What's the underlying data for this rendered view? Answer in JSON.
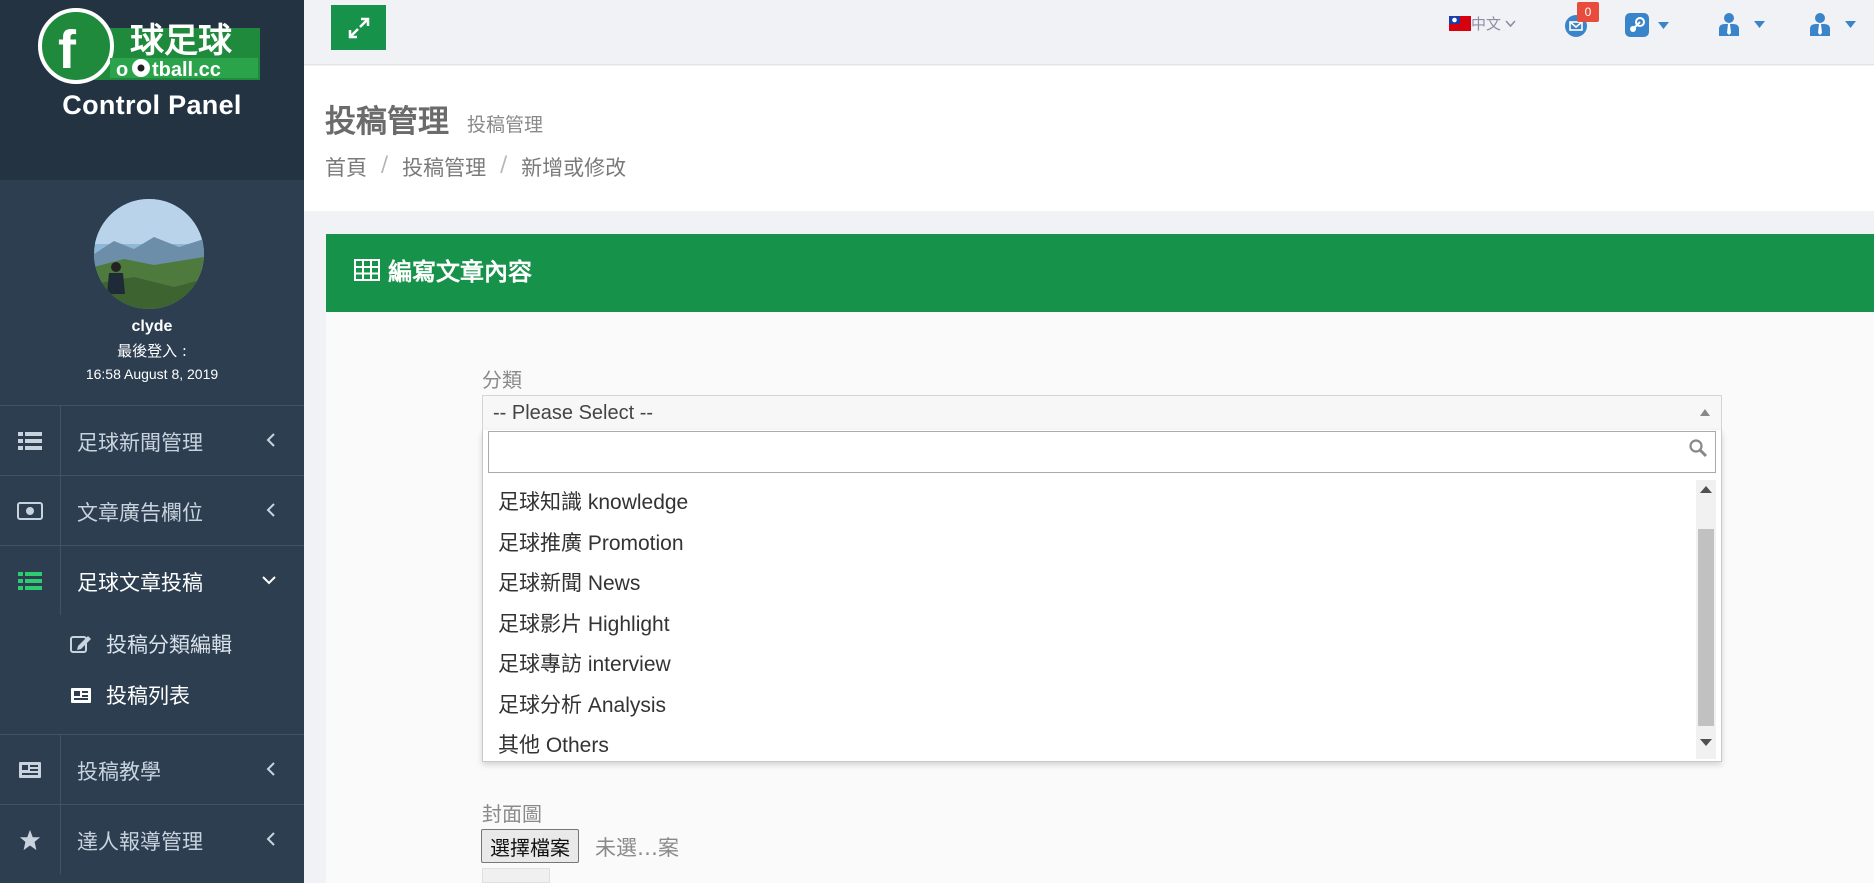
{
  "sidebar": {
    "logo_text": "football.cc 球足球",
    "title": "Control Panel",
    "user": {
      "name": "clyde",
      "last_login_label": "最後登入 :",
      "last_login_time": "16:58 August 8, 2019"
    },
    "menu": [
      {
        "label": "足球新聞管理",
        "icon": "list-icon",
        "expanded": false
      },
      {
        "label": "文章廣告欄位",
        "icon": "money-icon",
        "expanded": false
      },
      {
        "label": "足球文章投稿",
        "icon": "list-icon",
        "expanded": true
      },
      {
        "label": "投稿教學",
        "icon": "newspaper-icon",
        "expanded": false
      },
      {
        "label": "達人報導管理",
        "icon": "star-icon",
        "expanded": false
      }
    ],
    "submenu": [
      {
        "label": "投稿分類編輯",
        "icon": "edit-icon"
      },
      {
        "label": "投稿列表",
        "icon": "newspaper-icon"
      }
    ]
  },
  "topbar": {
    "language": "中文",
    "mail_count": "0"
  },
  "header": {
    "title": "投稿管理",
    "subtitle": "投稿管理",
    "breadcrumb": [
      "首頁",
      "投稿管理",
      "新增或修改"
    ]
  },
  "panel": {
    "title": "編寫文章內容"
  },
  "form": {
    "category_label": "分類",
    "category_value": "-- Please Select --",
    "search_value": "",
    "options": [
      "足球知識 knowledge",
      "足球推廣 Promotion",
      "足球新聞 News",
      "足球影片 Highlight",
      "足球專訪 interview",
      "足球分析 Analysis",
      "其他 Others"
    ],
    "cover_label": "封面圖",
    "file_button": "選擇檔案",
    "file_status": "未選…案"
  },
  "colors": {
    "brand_green": "#16924a",
    "sidebar_bg": "#2c3e50",
    "badge_red": "#e74c3c"
  }
}
